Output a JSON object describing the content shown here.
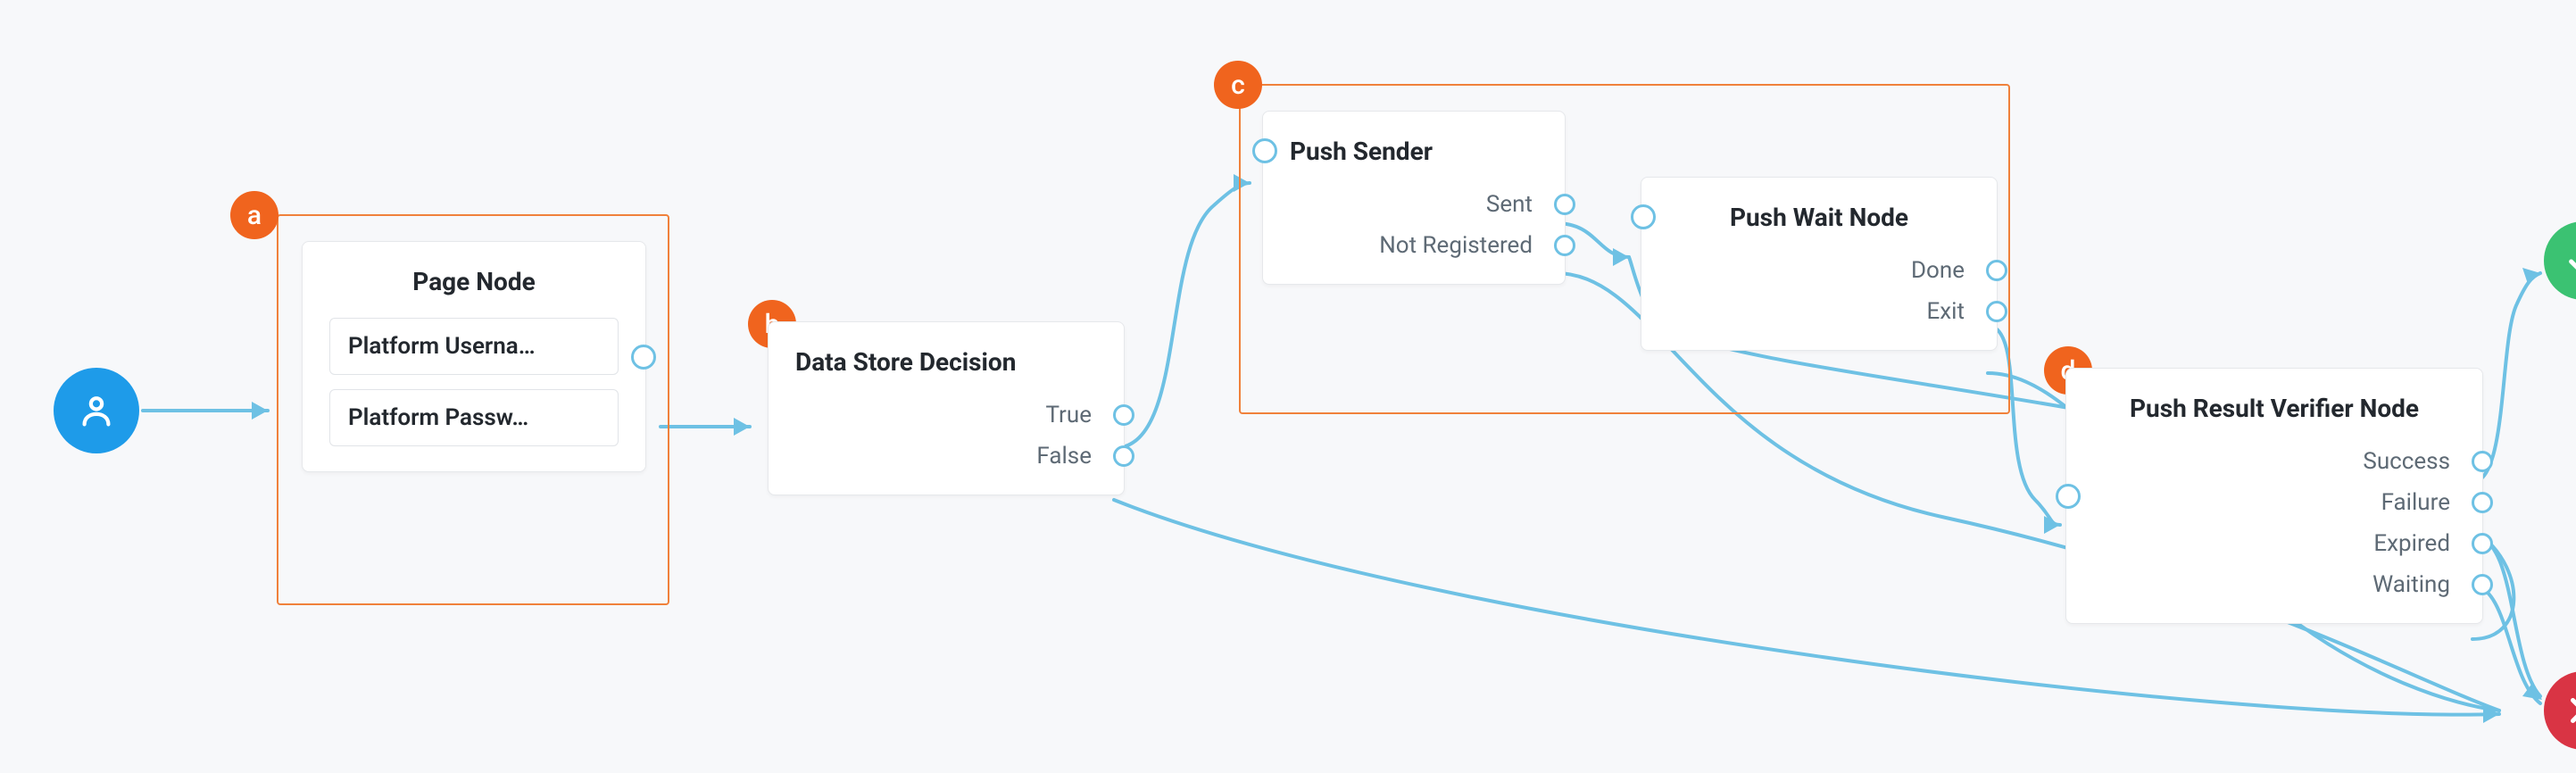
{
  "startIcon": "user",
  "groups": {
    "a": {
      "label": "a"
    },
    "b": {
      "label": "b"
    },
    "c": {
      "label": "c"
    },
    "d": {
      "label": "d"
    }
  },
  "nodes": {
    "pageNode": {
      "title": "Page Node",
      "fields": [
        "Platform Userna…",
        "Platform Passw…"
      ]
    },
    "dataStore": {
      "title": "Data Store Decision",
      "outputs": [
        "True",
        "False"
      ]
    },
    "pushSender": {
      "title": "Push Sender",
      "outputs": [
        "Sent",
        "Not Registered"
      ]
    },
    "pushWait": {
      "title": "Push Wait Node",
      "outputs": [
        "Done",
        "Exit"
      ]
    },
    "pushResult": {
      "title": "Push Result Verifier Node",
      "outputs": [
        "Success",
        "Failure",
        "Expired",
        "Waiting"
      ]
    }
  },
  "terminals": {
    "success": "check",
    "fail": "cross"
  }
}
